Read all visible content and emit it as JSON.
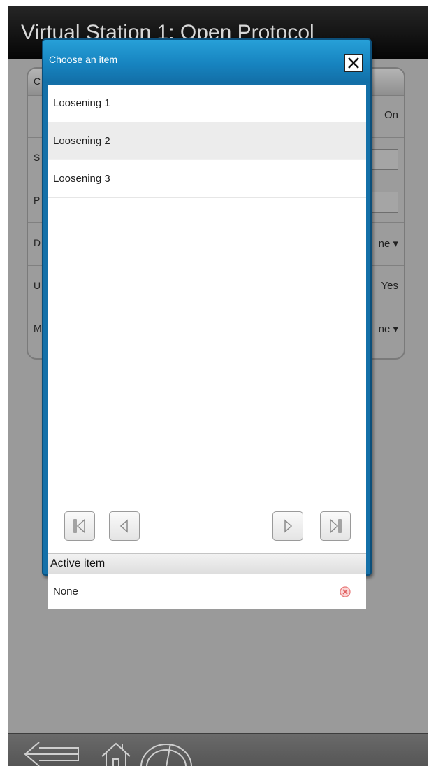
{
  "app": {
    "title": "Virtual Station 1: Open Protocol"
  },
  "settings": {
    "rows": [
      {
        "label": "S",
        "value": ""
      },
      {
        "label": "P",
        "value": ""
      },
      {
        "label": "D",
        "value": "ne ▾"
      },
      {
        "label": "U",
        "value": "Yes"
      },
      {
        "label": "M",
        "value": "ne ▾"
      }
    ],
    "first_value": "On",
    "header_letter": "C"
  },
  "dialog": {
    "title": "Choose an item",
    "items": [
      {
        "label": "Loosening 1"
      },
      {
        "label": "Loosening 2"
      },
      {
        "label": "Loosening 3"
      }
    ],
    "active_header": "Active item",
    "active_value": "None"
  },
  "icons": {
    "close": "close-icon",
    "first": "first-page-icon",
    "prev": "previous-page-icon",
    "next": "next-page-icon",
    "last": "last-page-icon",
    "clear": "clear-icon",
    "back": "back-arrow-icon",
    "home": "home-icon",
    "gauge": "gauge-icon"
  },
  "colors": {
    "dialog_accent": "#1784c0",
    "clear_icon": "#e87878"
  }
}
